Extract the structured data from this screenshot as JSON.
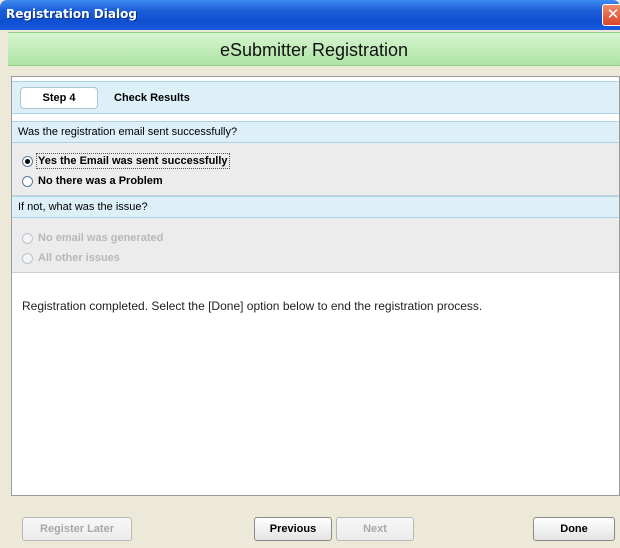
{
  "window": {
    "title": "Registration Dialog",
    "close_glyph": "✕"
  },
  "banner": {
    "title": "eSubmitter Registration"
  },
  "step": {
    "label": "Step 4",
    "title": "Check Results"
  },
  "question1": {
    "text": "Was the registration email sent successfully?",
    "options": [
      {
        "label": "Yes the Email was sent successfully",
        "checked": true,
        "enabled": true
      },
      {
        "label": "No there was a Problem",
        "checked": false,
        "enabled": true
      }
    ]
  },
  "question2": {
    "text": "If not, what was the issue?",
    "options": [
      {
        "label": "No email was generated",
        "checked": false,
        "enabled": false
      },
      {
        "label": "All other issues",
        "checked": false,
        "enabled": false
      }
    ]
  },
  "message": "Registration completed. Select the [Done] option below to end the registration process.",
  "buttons": {
    "register_later": "Register Later",
    "previous": "Previous",
    "next": "Next",
    "done": "Done"
  }
}
